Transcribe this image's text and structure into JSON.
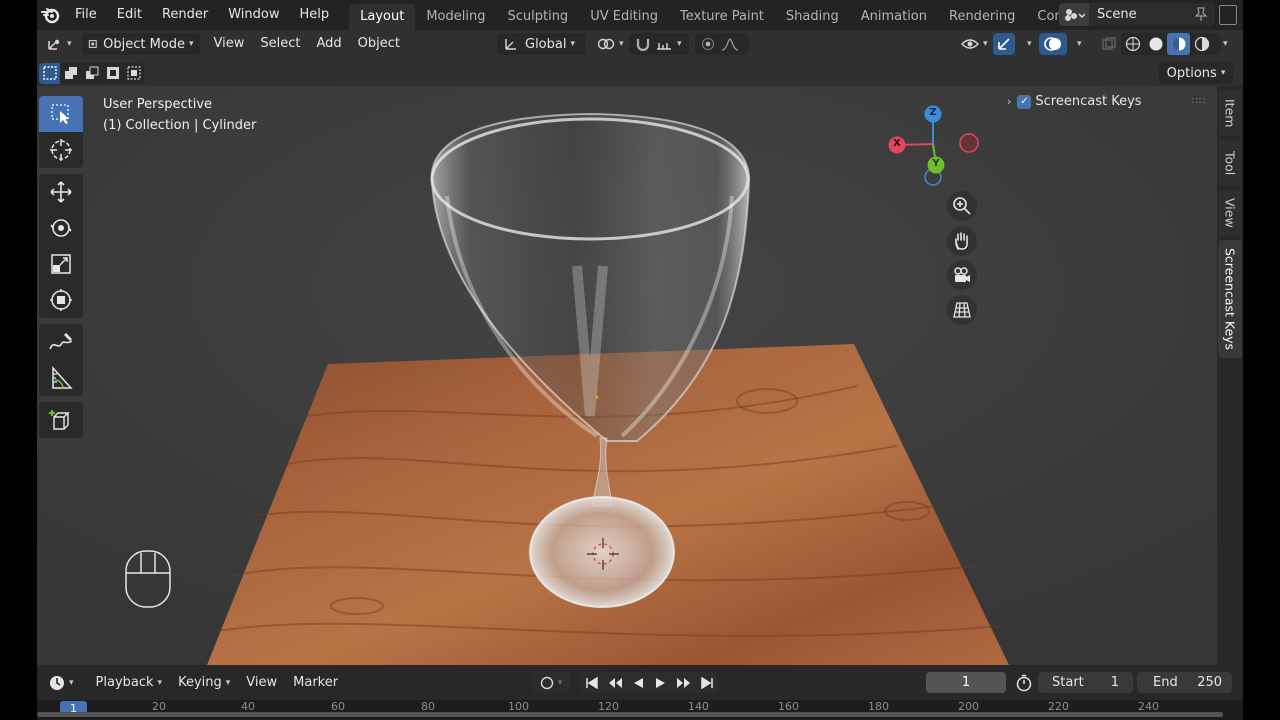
{
  "topbar": {
    "menu": [
      "File",
      "Edit",
      "Render",
      "Window",
      "Help"
    ],
    "workspaces": [
      "Layout",
      "Modeling",
      "Sculpting",
      "UV Editing",
      "Texture Paint",
      "Shading",
      "Animation",
      "Rendering",
      "Compositin"
    ],
    "active_workspace": "Layout",
    "scene": "Scene"
  },
  "header": {
    "mode": "Object Mode",
    "menus": [
      "View",
      "Select",
      "Add",
      "Object"
    ],
    "orientation": "Global",
    "options_label": "Options"
  },
  "viewport": {
    "perspective_label": "User Perspective",
    "collection_label": "(1) Collection | Cylinder",
    "gizmo": {
      "x": "X",
      "y": "Y",
      "z": "Z"
    },
    "screencast_keys_label": "Screencast Keys",
    "screencast_keys_enabled": true
  },
  "sidebar_tabs": [
    "Item",
    "Tool",
    "View",
    "Screencast Keys"
  ],
  "active_sidebar_tab": "Screencast Keys",
  "timeline": {
    "menus": [
      "Playback",
      "Keying",
      "View",
      "Marker"
    ],
    "current_frame": "1",
    "start_label": "Start",
    "start_value": "1",
    "end_label": "End",
    "end_value": "250",
    "ruler_ticks": [
      "20",
      "40",
      "60",
      "80",
      "100",
      "120",
      "140",
      "160",
      "180",
      "200",
      "220",
      "240"
    ]
  },
  "colors": {
    "accent": "#4772b3",
    "axis_x": "#e3475b",
    "axis_y": "#6dbd2f",
    "axis_z": "#3f8cdc"
  }
}
